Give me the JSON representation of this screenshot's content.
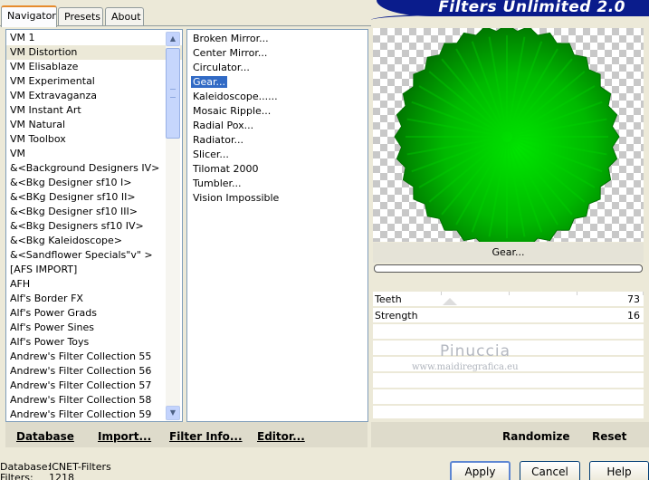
{
  "tabs": [
    "Navigator",
    "Presets",
    "About"
  ],
  "banner_title": "Filters Unlimited 2.0",
  "categories": [
    "VM 1",
    "VM Distortion",
    "VM Elisablaze",
    "VM Experimental",
    "VM Extravaganza",
    "VM Instant Art",
    "VM Natural",
    "VM Toolbox",
    "VM",
    "&<Background Designers IV>",
    "&<Bkg Designer sf10 I>",
    "&<BKg Designer sf10 II>",
    "&<Bkg Designer sf10 III>",
    "&<Bkg Designers sf10 IV>",
    "&<Bkg Kaleidoscope>",
    "&<Sandflower Specials\"v\" >",
    "[AFS IMPORT]",
    "AFH",
    "Alf's Border FX",
    "Alf's Power Grads",
    "Alf's Power Sines",
    "Alf's Power Toys",
    "Andrew's Filter Collection 55",
    "Andrew's Filter Collection 56",
    "Andrew's Filter Collection 57",
    "Andrew's Filter Collection 58",
    "Andrew's Filter Collection 59"
  ],
  "selected_category": "VM Distortion",
  "filters": [
    "Broken Mirror...",
    "Center Mirror...",
    "Circulator...",
    "Gear...",
    "Kaleidoscope......",
    "Mosaic Ripple...",
    "Radial Pox...",
    "Radiator...",
    "Slicer...",
    "Tilomat 2000",
    "Tumbler...",
    "Vision Impossible"
  ],
  "selected_filter": "Gear...",
  "preview_filter_name": "Gear...",
  "params": [
    {
      "label": "Teeth",
      "value": "73"
    },
    {
      "label": "Strength",
      "value": "16"
    }
  ],
  "watermark": {
    "name": "Pinuccia",
    "site": "www.maidiregrafica.eu"
  },
  "left_actions": [
    "Database",
    "Import...",
    "Filter Info...",
    "Editor..."
  ],
  "right_actions": [
    "Randomize",
    "Reset"
  ],
  "status": [
    {
      "key": "Database:",
      "value": "ICNET-Filters"
    },
    {
      "key": "Filters:",
      "value": "1218"
    }
  ],
  "buttons": {
    "apply": "Apply",
    "cancel": "Cancel",
    "help": "Help"
  },
  "colors": {
    "selection": "#316ac5",
    "banner": "#0a1c8c",
    "gear_green": "#00c800"
  }
}
